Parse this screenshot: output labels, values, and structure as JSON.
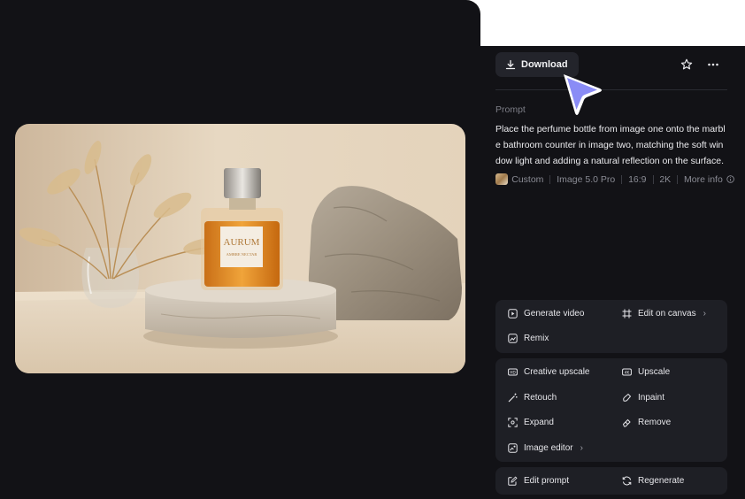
{
  "toolbar": {
    "download_label": "Download",
    "favorite_icon": "star-icon",
    "more_icon": "more-dots-icon"
  },
  "prompt": {
    "label": "Prompt",
    "text": "Place the perfume bottle from image one onto the marble bathroom counter in image two, matching the soft window light and adding a natural reflection on the surface."
  },
  "meta": {
    "style": "Custom",
    "model": "Image 5.0 Pro",
    "aspect_ratio": "16:9",
    "resolution": "2K",
    "more_info": "More info"
  },
  "image": {
    "label_brand": "AURUM",
    "label_sub": "AMBRE NECTAR"
  },
  "actions": {
    "group1": [
      {
        "label": "Generate video",
        "icon": "play-icon"
      },
      {
        "label": "Edit on canvas",
        "icon": "canvas-icon",
        "has_chevron": true
      },
      {
        "label": "Remix",
        "icon": "remix-icon"
      }
    ],
    "group2": [
      {
        "label": "Creative upscale",
        "icon": "hd-icon"
      },
      {
        "label": "Upscale",
        "icon": "upscale-icon"
      },
      {
        "label": "Retouch",
        "icon": "wand-icon"
      },
      {
        "label": "Inpaint",
        "icon": "inpaint-icon"
      },
      {
        "label": "Expand",
        "icon": "expand-icon"
      },
      {
        "label": "Remove",
        "icon": "eraser-icon"
      },
      {
        "label": "Image editor",
        "icon": "image-editor-icon",
        "has_chevron": true
      }
    ],
    "group3": [
      {
        "label": "Edit prompt",
        "icon": "edit-prompt-icon"
      },
      {
        "label": "Regenerate",
        "icon": "regenerate-icon"
      }
    ]
  },
  "colors": {
    "panel_bg": "#121216",
    "group_bg": "#1e1f25",
    "button_bg": "#23242b",
    "cursor": "#8a8cf6"
  }
}
